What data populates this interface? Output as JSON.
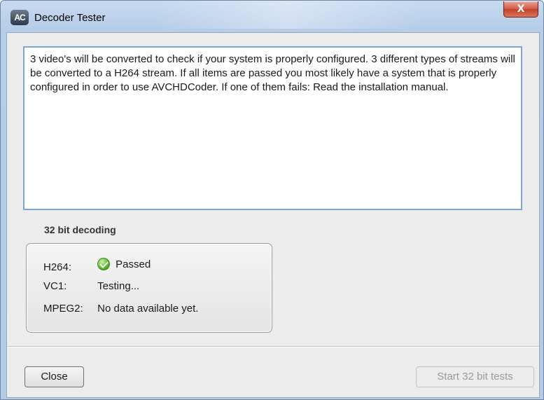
{
  "window": {
    "title": "Decoder Tester",
    "app_icon_text": "AC",
    "close_glyph": "X"
  },
  "description": "3 video's will be converted to check if your system is properly configured. 3 different types of streams will be converted to a H264 stream. If all items are passed you most likely have a system that is properly configured in order to use AVCHDCoder. If one of them fails: Read the installation manual.",
  "decoding_group": {
    "label": "32 bit decoding",
    "rows": [
      {
        "label": "H264:",
        "status": "Passed",
        "icon": "check-circle-icon"
      },
      {
        "label": "VC1:",
        "status": "Testing..."
      },
      {
        "label": "MPEG2:",
        "status": "No data available yet."
      }
    ]
  },
  "buttons": {
    "close": "Close",
    "start": "Start 32 bit tests"
  },
  "colors": {
    "title_bar": "#b9d0ea",
    "close_button": "#c8503a",
    "passed_icon": "#56b22a",
    "disabled_text": "#9a9a9a"
  }
}
